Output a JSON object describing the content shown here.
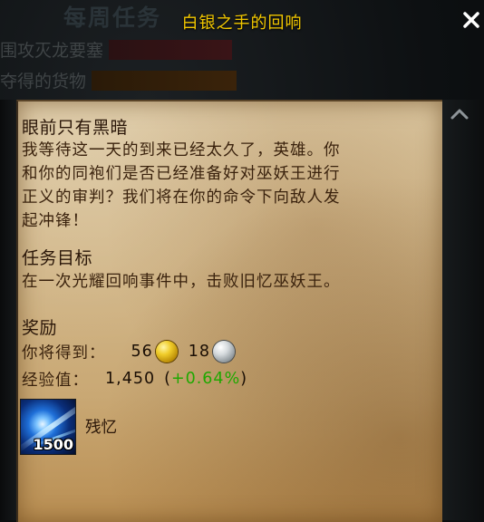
{
  "window": {
    "bg_title": "每周任务",
    "quest_title": "白银之手的回响"
  },
  "quest_list": [
    {
      "label": "围攻灭龙要塞",
      "bar_color": "#3a1417"
    },
    {
      "label": "夺得的货物",
      "bar_color": "#3a230a"
    }
  ],
  "quest": {
    "title": "眼前只有黑暗",
    "description_lines": [
      "我等待这一天的到来已经太久了，英雄。你",
      "和你的同袍们是否已经准备好对巫妖王进行",
      "正义的审判？我们将在你的命令下向敌人发",
      "起冲锋！"
    ],
    "objective_heading": "任务目标",
    "objective_text": "在一次光耀回响事件中，击败旧忆巫妖王。",
    "rewards_heading": "奖励",
    "receive_label": "你将得到：",
    "gold": "56",
    "silver": "18",
    "xp_label": "经验值：",
    "xp_value": "1,450",
    "xp_pct_open": "(",
    "xp_pct": "+0.64%",
    "xp_pct_close": ")",
    "item_name": "残忆",
    "item_count": "1500"
  },
  "colors": {
    "title_gold": "#f3c800",
    "xp_green": "#1fa800"
  },
  "icons": {
    "close": "close-icon",
    "scroll_up": "chevron-up-icon",
    "gold": "gold-coin-icon",
    "silver": "silver-coin-icon",
    "item": "remnant-item-icon"
  }
}
